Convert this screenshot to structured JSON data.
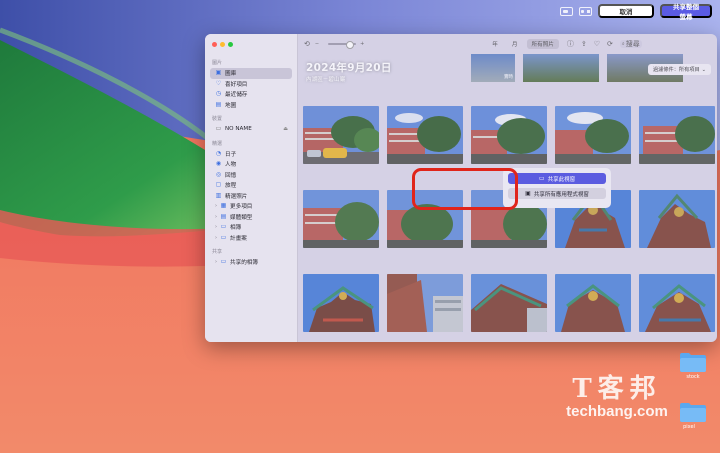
{
  "capture_bar": {
    "cancel_label": "取消",
    "share_label": "共享整個螢幕"
  },
  "sidebar": {
    "sections": [
      {
        "title": "圖片",
        "items": [
          {
            "label": "圖庫",
            "icon": "photo-library-icon",
            "active": true
          },
          {
            "label": "喜好項目",
            "icon": "heart-icon"
          },
          {
            "label": "最近儲存",
            "icon": "clock-icon"
          },
          {
            "label": "地圖",
            "icon": "map-icon"
          }
        ]
      },
      {
        "title": "裝置",
        "items": [
          {
            "label": "NO NAME",
            "icon": "drive-icon",
            "eject": true
          }
        ]
      },
      {
        "title": "精選",
        "items": [
          {
            "label": "日子",
            "icon": "calendar-icon"
          },
          {
            "label": "人物",
            "icon": "person-icon"
          },
          {
            "label": "回憶",
            "icon": "memories-icon"
          },
          {
            "label": "旅程",
            "icon": "suitcase-icon"
          },
          {
            "label": "精選照片",
            "icon": "featured-photos-icon"
          },
          {
            "label": "更多項目",
            "icon": "more-items-icon",
            "chevron": true
          },
          {
            "label": "媒體類型",
            "icon": "media-types-icon",
            "chevron": true
          },
          {
            "label": "相簿",
            "icon": "album-icon",
            "chevron": true
          },
          {
            "label": "計畫案",
            "icon": "projects-icon",
            "chevron": true
          }
        ]
      },
      {
        "title": "共享",
        "items": [
          {
            "label": "共享的相簿",
            "icon": "shared-album-icon",
            "chevron": true
          }
        ]
      }
    ]
  },
  "toolbar": {
    "tabs": [
      {
        "label": "年"
      },
      {
        "label": "月"
      },
      {
        "label": "所有照片",
        "active": true
      }
    ],
    "search_placeholder": "搜尋"
  },
  "library": {
    "date_heading": "2024年9月20日",
    "date_subtitle": "內湖區－碧山巖",
    "filter_label": "過濾條件：所有項目",
    "badge": "實時"
  },
  "share_popover": {
    "primary_label": "共享此視窗",
    "secondary_label": "共享所有應用程式視窗"
  },
  "desktop": {
    "folders": [
      {
        "label": "stock"
      },
      {
        "label": "pixel"
      }
    ],
    "watermark_cn": "T客邦",
    "watermark_en": "techbang.com"
  },
  "colors": {
    "accent": "#5b5ce0",
    "highlight": "#e0251b"
  }
}
